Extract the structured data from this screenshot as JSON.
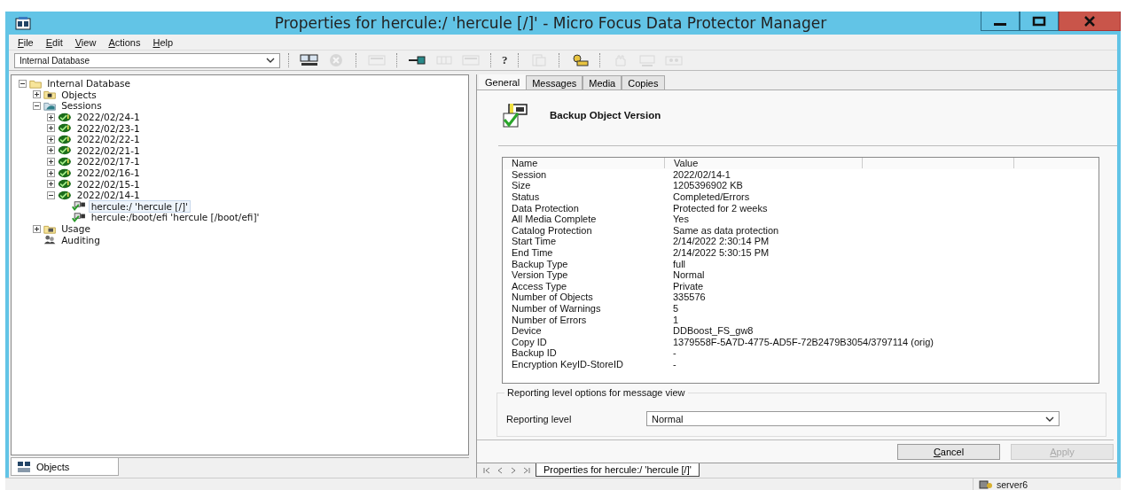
{
  "window": {
    "title": "Properties for hercule:/ 'hercule [/]' - Micro Focus Data Protector Manager"
  },
  "menu": [
    "File",
    "Edit",
    "View",
    "Actions",
    "Help"
  ],
  "context_select": {
    "value": "Internal Database"
  },
  "toolbar": [
    {
      "kind": "computer",
      "disabled": false
    },
    {
      "kind": "cancel",
      "disabled": true
    },
    {
      "kind": "separator"
    },
    {
      "kind": "panel",
      "disabled": true
    },
    {
      "kind": "separator"
    },
    {
      "kind": "pin",
      "disabled": false
    },
    {
      "kind": "grid",
      "disabled": true
    },
    {
      "kind": "panel",
      "disabled": true
    },
    {
      "kind": "separator"
    },
    {
      "kind": "help",
      "label": "?",
      "disabled": false
    },
    {
      "kind": "separator"
    },
    {
      "kind": "copy",
      "disabled": true
    },
    {
      "kind": "separator"
    },
    {
      "kind": "keys",
      "disabled": false
    },
    {
      "kind": "separator"
    },
    {
      "kind": "hand",
      "disabled": true
    },
    {
      "kind": "monitor",
      "disabled": true
    },
    {
      "kind": "tape",
      "disabled": true
    }
  ],
  "tree": [
    {
      "label": "Internal Database",
      "kind": "folder",
      "expanded": true,
      "selected": false,
      "children": [
        {
          "label": "Objects",
          "kind": "objects",
          "expanded": false,
          "selected": false
        },
        {
          "label": "Sessions",
          "kind": "sessions",
          "expanded": true,
          "selected": false,
          "children": [
            {
              "label": "2022/02/24-1",
              "kind": "session",
              "expanded": false,
              "selected": false
            },
            {
              "label": "2022/02/23-1",
              "kind": "session",
              "expanded": false,
              "selected": false
            },
            {
              "label": "2022/02/22-1",
              "kind": "session",
              "expanded": false,
              "selected": false
            },
            {
              "label": "2022/02/21-1",
              "kind": "session",
              "expanded": false,
              "selected": false
            },
            {
              "label": "2022/02/17-1",
              "kind": "session",
              "expanded": false,
              "selected": false
            },
            {
              "label": "2022/02/16-1",
              "kind": "session",
              "expanded": false,
              "selected": false
            },
            {
              "label": "2022/02/15-1",
              "kind": "session",
              "expanded": false,
              "selected": false
            },
            {
              "label": "2022/02/14-1",
              "kind": "session",
              "expanded": true,
              "selected": false,
              "children": [
                {
                  "label": "hercule:/ 'hercule [/]'",
                  "kind": "object",
                  "selected": true
                },
                {
                  "label": "hercule:/boot/efi 'hercule [/boot/efi]'",
                  "kind": "object",
                  "selected": false
                }
              ]
            }
          ]
        },
        {
          "label": "Usage",
          "kind": "usage",
          "expanded": false,
          "selected": false
        },
        {
          "label": "Auditing",
          "kind": "auditing",
          "selected": false
        }
      ]
    }
  ],
  "left_tabs": [
    {
      "label": "Objects",
      "selected": true
    }
  ],
  "tabs": [
    {
      "label": "General",
      "selected": true
    },
    {
      "label": "Messages",
      "selected": false
    },
    {
      "label": "Media",
      "selected": false
    },
    {
      "label": "Copies",
      "selected": false
    }
  ],
  "header": {
    "title": "Backup Object Version"
  },
  "properties": {
    "columns": [
      "Name",
      "Value"
    ],
    "rows": [
      {
        "name": "Session",
        "value": "2022/02/14-1"
      },
      {
        "name": "Size",
        "value": "1205396902 KB"
      },
      {
        "name": "Status",
        "value": "Completed/Errors"
      },
      {
        "name": "Data Protection",
        "value": "Protected for 2 weeks"
      },
      {
        "name": "All Media Complete",
        "value": "Yes"
      },
      {
        "name": "Catalog Protection",
        "value": "Same as data protection"
      },
      {
        "name": "Start Time",
        "value": "2/14/2022 2:30:14 PM"
      },
      {
        "name": "End Time",
        "value": "2/14/2022 5:30:15 PM"
      },
      {
        "name": "Backup Type",
        "value": "full"
      },
      {
        "name": "Version Type",
        "value": "Normal"
      },
      {
        "name": "Access Type",
        "value": "Private"
      },
      {
        "name": "Number of Objects",
        "value": "335576"
      },
      {
        "name": "Number of Warnings",
        "value": "5"
      },
      {
        "name": "Number of Errors",
        "value": "1"
      },
      {
        "name": "Device",
        "value": "DDBoost_FS_gw8"
      },
      {
        "name": "Copy ID",
        "value": "1379558F-5A7D-4775-AD5F-72B2479B3054/3797114 (orig)"
      },
      {
        "name": "Backup ID",
        "value": "-"
      },
      {
        "name": "Encryption KeyID-StoreID",
        "value": "-"
      }
    ]
  },
  "reporting": {
    "group_title": "Reporting level options for message view",
    "label": "Reporting level",
    "value": "Normal"
  },
  "buttons": [
    {
      "label": "Cancel",
      "disabled": false
    },
    {
      "label": "Apply",
      "disabled": true
    }
  ],
  "document_tabs": [
    {
      "label": "Properties for hercule:/ 'hercule [/]'",
      "selected": true
    }
  ],
  "status_bar": {
    "server": "server6"
  }
}
